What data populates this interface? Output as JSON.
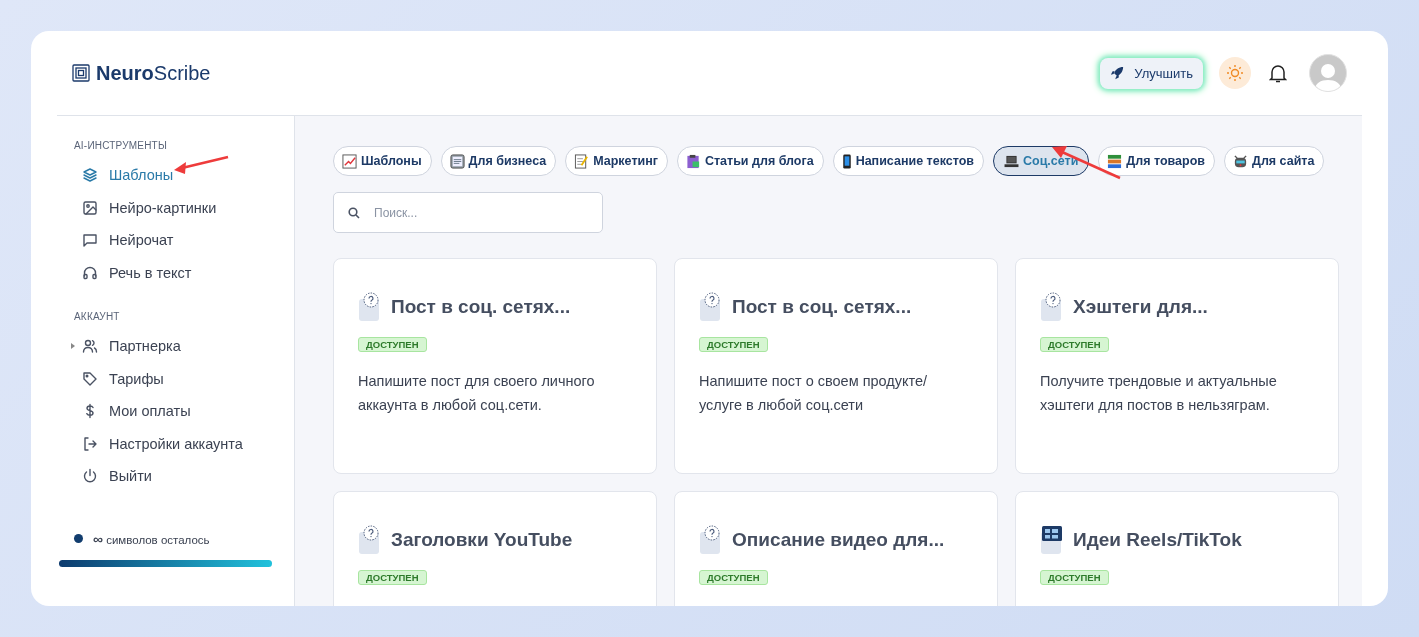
{
  "header": {
    "logo_bold": "Neuro",
    "logo_rest": "Scribe",
    "upgrade_button": "Улучшить"
  },
  "sidebar": {
    "sections": [
      {
        "title": "AI-ИНСТРУМЕНТЫ",
        "items": [
          {
            "label": "Шаблоны",
            "selected": true
          },
          {
            "label": "Нейро-картинки",
            "selected": false
          },
          {
            "label": "Нейрочат",
            "selected": false
          },
          {
            "label": "Речь в текст",
            "selected": false
          }
        ]
      },
      {
        "title": "АККАУНТ",
        "items": [
          {
            "label": "Партнерка",
            "selected": false,
            "expanded": false
          },
          {
            "label": "Тарифы",
            "selected": false
          },
          {
            "label": "Мои оплаты",
            "selected": false
          },
          {
            "label": "Настройки аккаунта",
            "selected": false
          },
          {
            "label": "Выйти",
            "selected": false
          }
        ]
      }
    ],
    "quota": {
      "symbol": "∞",
      "text": "символов осталось",
      "level": 1
    }
  },
  "categories": [
    {
      "label": "Шаблоны",
      "selected": false
    },
    {
      "label": "Для бизнеса",
      "selected": false
    },
    {
      "label": "Маркетинг",
      "selected": false
    },
    {
      "label": "Статьи для блога",
      "selected": false
    },
    {
      "label": "Написание текстов",
      "selected": false
    },
    {
      "label": "Соц.сети",
      "selected": true
    },
    {
      "label": "Для товаров",
      "selected": false
    },
    {
      "label": "Для сайта",
      "selected": false
    }
  ],
  "search": {
    "placeholder": "Поиск..."
  },
  "cards": [
    {
      "kind": "question",
      "title": "Пост в соц. сетях...",
      "badge": "ДОСТУПЕН",
      "description": "Напишите пост для своего личного аккаунта в любой соц.сети."
    },
    {
      "kind": "question",
      "title": "Пост в соц. сетях...",
      "badge": "ДОСТУПЕН",
      "description": "Напишите пост о своем продукте/ услуге в любой соц.сети"
    },
    {
      "kind": "question",
      "title": "Хэштеги для...",
      "badge": "ДОСТУПЕН",
      "description": "Получите трендовые и актуальные хэштеги для постов в нельзяграм."
    },
    {
      "kind": "question",
      "title": "Заголовки YouTube",
      "badge": "ДОСТУПЕН"
    },
    {
      "kind": "question",
      "title": "Описание видео для...",
      "badge": "ДОСТУПЕН"
    },
    {
      "kind": "film",
      "title": "Идеи Reels/TikTok",
      "badge": "ДОСТУПЕН"
    }
  ]
}
